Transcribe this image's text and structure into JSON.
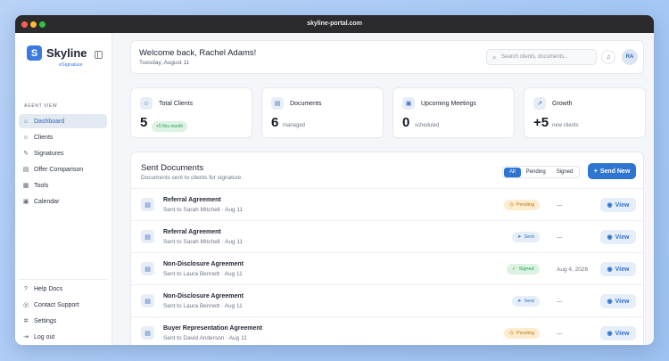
{
  "window": {
    "url": "skyline-portal.com"
  },
  "brand": {
    "name": "Skyline",
    "sub": "eSignature",
    "logo_letter": "S",
    "accent": "#3b7be0"
  },
  "sidebar": {
    "section": "AGENT VIEW",
    "items": [
      {
        "label": "Dashboard",
        "icon": "home-icon"
      },
      {
        "label": "Clients",
        "icon": "users-icon"
      },
      {
        "label": "Signatures",
        "icon": "signature-icon"
      },
      {
        "label": "Offer Comparison",
        "icon": "compare-icon"
      },
      {
        "label": "Tools",
        "icon": "tools-icon"
      },
      {
        "label": "Calendar",
        "icon": "calendar-icon"
      }
    ],
    "bottom": [
      {
        "label": "Help Docs",
        "icon": "help-icon"
      },
      {
        "label": "Contact Support",
        "icon": "support-icon"
      },
      {
        "label": "Settings",
        "icon": "gear-icon"
      },
      {
        "label": "Log out",
        "icon": "logout-icon"
      }
    ]
  },
  "header": {
    "welcome": "Welcome back, Rachel Adams!",
    "date": "Tuesday, August 11",
    "search_placeholder": "Search clients, documents...",
    "avatar": "RA"
  },
  "stats": [
    {
      "label": "Total Clients",
      "value": "5",
      "badge": "+5 this month"
    },
    {
      "label": "Documents",
      "value": "6",
      "sub": "managed"
    },
    {
      "label": "Upcoming Meetings",
      "value": "0",
      "sub": "scheduled"
    },
    {
      "label": "Growth",
      "value": "+5",
      "sub": "new clients"
    }
  ],
  "documents": {
    "title": "Sent Documents",
    "subtitle": "Documents sent to clients for signature",
    "filters": [
      "All",
      "Pending",
      "Signed"
    ],
    "send_label": "Send New",
    "view_label": "View",
    "rows": [
      {
        "name": "Referral Agreement",
        "to": "Sent to Sarah Mitchell · Aug 11",
        "status": "Pending",
        "signed_date": "—"
      },
      {
        "name": "Referral Agreement",
        "to": "Sent to Sarah Mitchell · Aug 11",
        "status": "Sent",
        "signed_date": "—"
      },
      {
        "name": "Non-Disclosure Agreement",
        "to": "Sent to Laura Bennett · Aug 11",
        "status": "Signed",
        "signed_date": "Aug 4, 2026"
      },
      {
        "name": "Non-Disclosure Agreement",
        "to": "Sent to Laura Bennett · Aug 11",
        "status": "Sent",
        "signed_date": "—"
      },
      {
        "name": "Buyer Representation Agreement",
        "to": "Sent to David Anderson · Aug 11",
        "status": "Pending",
        "signed_date": "—"
      }
    ]
  }
}
